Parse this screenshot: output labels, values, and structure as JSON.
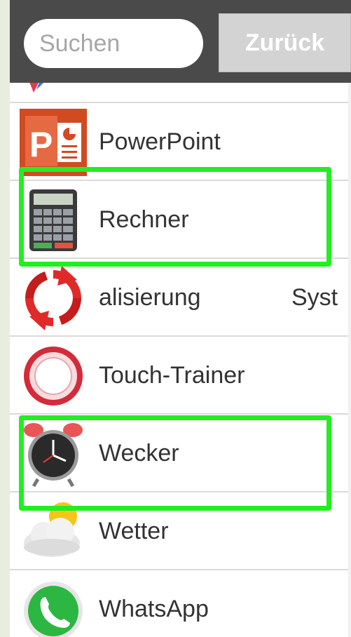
{
  "search": {
    "placeholder": "Suchen"
  },
  "header": {
    "back_label": "Zurück"
  },
  "apps": [
    {
      "label": "",
      "icon": "play-store-icon"
    },
    {
      "label": "PowerPoint",
      "icon": "powerpoint-icon"
    },
    {
      "label": "Rechner",
      "icon": "calculator-icon"
    },
    {
      "label": "alisierung",
      "label_right": "Syst",
      "icon": "update-icon"
    },
    {
      "label": "Touch-Trainer",
      "icon": "touch-trainer-icon"
    },
    {
      "label": "Wecker",
      "icon": "alarm-clock-icon"
    },
    {
      "label": "Wetter",
      "icon": "weather-icon"
    },
    {
      "label": "WhatsApp",
      "icon": "whatsapp-icon"
    }
  ],
  "colors": {
    "header_bg": "#4a4a4a",
    "highlight": "#22ee22",
    "back_button_bg": "#d3d3d3"
  }
}
